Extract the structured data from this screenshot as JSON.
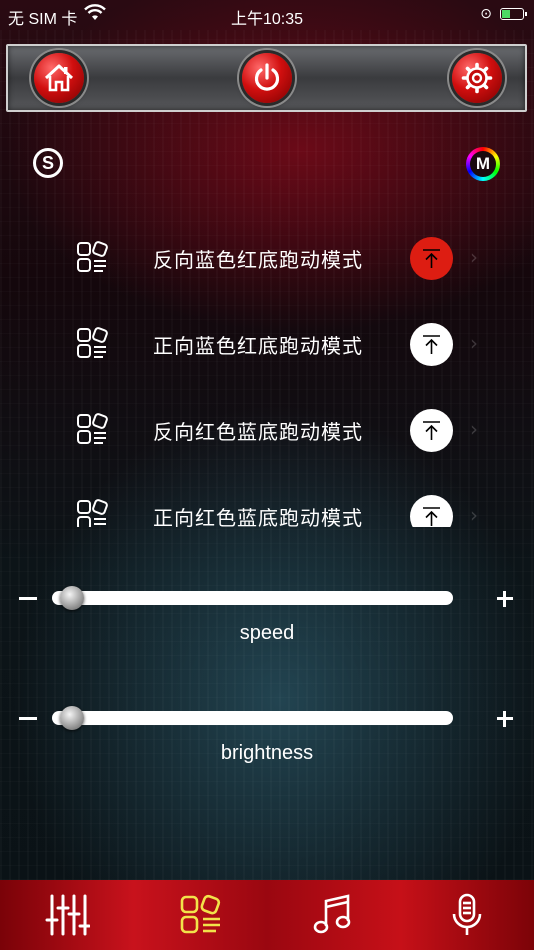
{
  "status_bar": {
    "carrier": "无 SIM 卡",
    "time": "上午10:35",
    "battery_level": 0.4
  },
  "toolbar": {
    "home_icon": "home-icon",
    "power_icon": "power-icon",
    "settings_icon": "gear-icon"
  },
  "badges": {
    "s_label": "S",
    "m_label": "M"
  },
  "modes": [
    {
      "label": "反向蓝色红底跑动模式",
      "active": true
    },
    {
      "label": "正向蓝色红底跑动模式",
      "active": false
    },
    {
      "label": "反向红色蓝底跑动模式",
      "active": false
    },
    {
      "label": "正向红色蓝底跑动模式",
      "active": false
    }
  ],
  "sliders": {
    "speed": {
      "label": "speed",
      "value": 0.02
    },
    "brightness": {
      "label": "brightness",
      "value": 0.02
    }
  },
  "colors": {
    "accent_red": "#dd1d12",
    "tab_active": "#f2e24a",
    "tabbar_red": "#c8121c"
  },
  "tabs": [
    {
      "icon": "equalizer-icon",
      "active": false
    },
    {
      "icon": "modes-icon",
      "active": true
    },
    {
      "icon": "music-note-icon",
      "active": false
    },
    {
      "icon": "microphone-icon",
      "active": false
    }
  ]
}
